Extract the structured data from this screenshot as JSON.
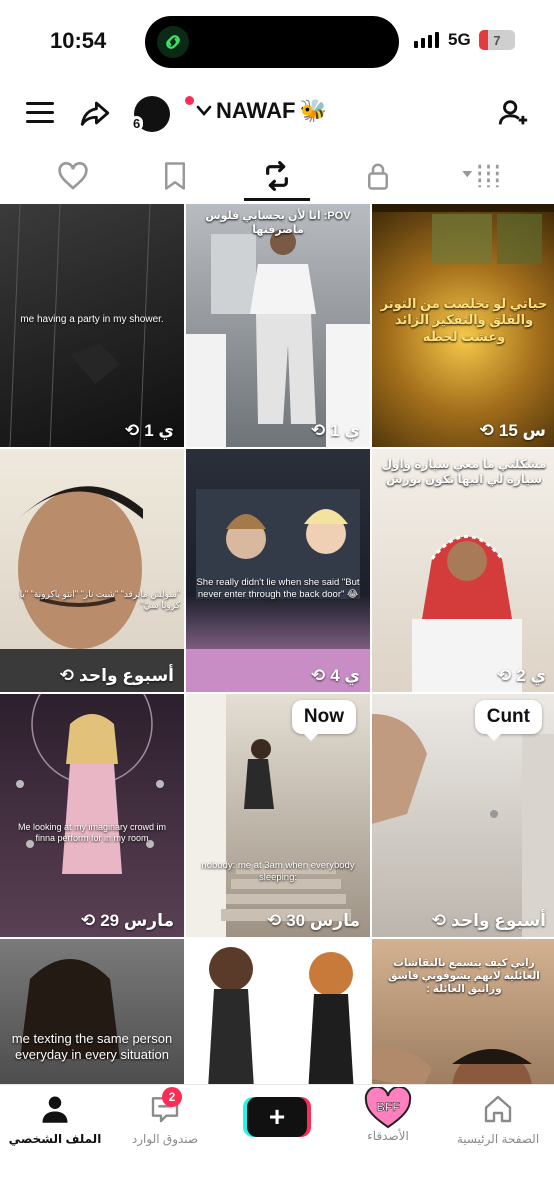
{
  "status_bar": {
    "time": "10:54",
    "network": "5G",
    "battery": "7"
  },
  "header": {
    "username": "NAWAF",
    "username_emoji": "🐝",
    "avatar_badge": "6"
  },
  "tabs": [
    {
      "name": "liked",
      "icon": "heart-icon"
    },
    {
      "name": "favorites",
      "icon": "bookmark-icon"
    },
    {
      "name": "reposts",
      "icon": "repost-icon",
      "active": true
    },
    {
      "name": "private",
      "icon": "lock-icon"
    },
    {
      "name": "filter",
      "icon": "sort-icon"
    }
  ],
  "grid": [
    {
      "caption": "me having a party in my shower.",
      "meta": "1 ي",
      "bg": [
        "#2b2b2b",
        "#151515"
      ]
    },
    {
      "caption": "POV: انا لأن بحسابي فلوس ماصرفتها",
      "meta": "1 ي",
      "bg": [
        "#8a8f94",
        "#4f5458"
      ]
    },
    {
      "caption": "حياتي لو تخلصت من التوتر والقلق والتفكير الزائد وعشت لحظه",
      "meta": "15 س",
      "bg": [
        "#c89a3a",
        "#5a3d10"
      ]
    },
    {
      "caption": "\"سولش ماترقد\"  \"شبت نار\"  \"انتو ياكرونة\"  \"يا كرونا سيّ\"",
      "meta": "أسبوع واحد",
      "bg": [
        "#e8e2d6",
        "#3a3a3a"
      ]
    },
    {
      "caption": "She really didn't lie when she said \"But never enter through the back door\" 😂",
      "meta": "4 ي",
      "bg": [
        "#6e4d8f",
        "#c98dc5"
      ]
    },
    {
      "caption": "مشكلتي ما معي سيارة واول سيارة لي ابيها تكون بورش",
      "meta": "2 ي",
      "bg": [
        "#f0ece4",
        "#c9b9a8"
      ]
    },
    {
      "caption": "Me looking at my imaginary crowd im finna perform for in my room",
      "meta": "29 مارس",
      "bg": [
        "#3a2a3a",
        "#d8a9b8"
      ]
    },
    {
      "caption": "nobody: me at 3am when everybody sleeping:",
      "sticker": "Now",
      "meta": "30 مارس",
      "bg": [
        "#d8d2c8",
        "#8a7f70"
      ]
    },
    {
      "caption": "",
      "sticker": "Cunt",
      "meta": "أسبوع واحد",
      "bg": [
        "#e9e6e2",
        "#b5aea6"
      ]
    },
    {
      "caption": "me texting the same person everyday in every situation",
      "meta": "",
      "bg": [
        "#6a6a6a",
        "#2e2e2e"
      ]
    },
    {
      "caption": "",
      "meta": "",
      "bg": [
        "#ffffff",
        "#eeeeee"
      ]
    },
    {
      "caption": "رايي كيف يتسمع بالنقاشات العائلية لانهم يشوفوني فاسق وزانيق العائلة :",
      "meta": "",
      "bg": [
        "#c8a888",
        "#7a5a40"
      ]
    }
  ],
  "bottom_nav": {
    "home": "الصفحة الرئيسية",
    "friends": "الأصدقاء",
    "friends_sticker": "BFF",
    "inbox": "صندوق الوارد",
    "inbox_badge": "2",
    "profile": "الملف الشخصي",
    "create": "+"
  }
}
